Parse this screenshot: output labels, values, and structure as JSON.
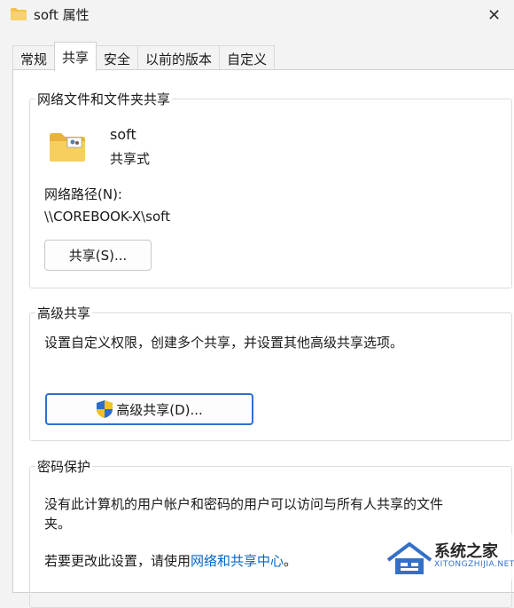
{
  "window": {
    "title": "soft 属性",
    "close_glyph": "✕"
  },
  "tabs": [
    {
      "label": "常规"
    },
    {
      "label": "共享",
      "active": true
    },
    {
      "label": "安全"
    },
    {
      "label": "以前的版本"
    },
    {
      "label": "自定义"
    }
  ],
  "network_sharing": {
    "title": "网络文件和文件夹共享",
    "folder_name": "soft",
    "share_status": "共享式",
    "path_label": "网络路径(N):",
    "path_value": "\\\\COREBOOK-X\\soft",
    "share_button": "共享(S)..."
  },
  "advanced_sharing": {
    "title": "高级共享",
    "description": "设置自定义权限，创建多个共享，并设置其他高级共享选项。",
    "button": "高级共享(D)..."
  },
  "password_protection": {
    "title": "密码保护",
    "description_line1": "没有此计算机的用户帐户和密码的用户可以访问与所有人共享的文件",
    "description_line2": "夹。",
    "change_prefix": "若要更改此设置，请使用",
    "change_link": "网络和共享中心",
    "change_suffix": "。"
  },
  "watermark": {
    "name": "系统之家",
    "url": "XITONGZHIJIA.NET"
  },
  "colors": {
    "link": "#0066cc",
    "focus_border": "#2f6fd1",
    "folder": "#f4c34d"
  }
}
